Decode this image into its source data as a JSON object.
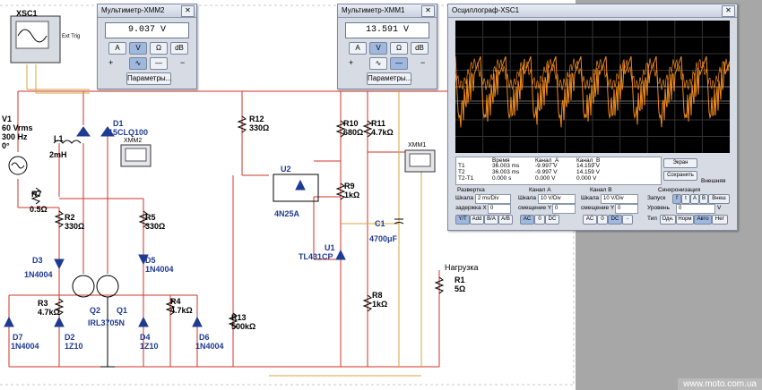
{
  "app": {
    "watermark": "www.moto.com.ua"
  },
  "xsc1_label": "XSC1",
  "xsc1_ext": "Ext Trig",
  "source": {
    "name": "V1",
    "amp": "60 Vrms",
    "freq": "300 Hz",
    "phase": "0°"
  },
  "components": {
    "L1": {
      "name": "L1",
      "value": "2mH"
    },
    "D1": {
      "name": "D1",
      "value": "15CLQ100"
    },
    "R7": {
      "name": "R7",
      "value": "0.5Ω"
    },
    "R2": {
      "name": "R2",
      "value": "330Ω"
    },
    "R5": {
      "name": "R5",
      "value": "330Ω"
    },
    "D3": {
      "name": "D3",
      "value": "1N4004"
    },
    "D5": {
      "name": "D5",
      "value": "1N4004"
    },
    "R3": {
      "name": "R3",
      "value": "4.7kΩ"
    },
    "R4": {
      "name": "R4",
      "value": "4.7kΩ"
    },
    "Q2": {
      "name": "Q2"
    },
    "Q1": {
      "name": "Q1",
      "value": "IRL3705N"
    },
    "D7": {
      "name": "D7",
      "value": "1N4004"
    },
    "D2": {
      "name": "D2",
      "value": "1Z10"
    },
    "D4": {
      "name": "D4",
      "value": "1Z10"
    },
    "D6": {
      "name": "D6",
      "value": "1N4004"
    },
    "R12": {
      "name": "R12",
      "value": "330Ω"
    },
    "R13": {
      "name": "R13",
      "value": "500kΩ"
    },
    "U2": {
      "name": "U2",
      "value": "4N25A"
    },
    "R10": {
      "name": "R10",
      "value": "680Ω"
    },
    "R11": {
      "name": "R11",
      "value": "4.7kΩ"
    },
    "R9": {
      "name": "R9",
      "value": "1kΩ"
    },
    "U1": {
      "name": "U1",
      "value": "TL431CP"
    },
    "C1": {
      "name": "C1",
      "value": "4700μF"
    },
    "R8": {
      "name": "R8",
      "value": "1kΩ"
    },
    "R1": {
      "name": "R1",
      "value": "5Ω",
      "label": "Нагрузка"
    },
    "XMM2": {
      "name": "XMM2"
    },
    "XMM1": {
      "name": "XMM1"
    }
  },
  "multimeter2": {
    "title": "Мультиметр-XMM2",
    "reading": "9.037 V",
    "mode_buttons": [
      "A",
      "V",
      "Ω",
      "dB"
    ],
    "plus": "+",
    "minus": "−",
    "params": "Параметры..."
  },
  "multimeter1": {
    "title": "Мультиметр-XMM1",
    "reading": "13.591 V",
    "mode_buttons": [
      "A",
      "V",
      "Ω",
      "dB"
    ],
    "plus": "+",
    "minus": "−",
    "params": "Параметры..."
  },
  "oscilloscope": {
    "title": "Осциллограф-XSC1",
    "colors": {
      "trace": "#f08a1c",
      "screen": "#000000",
      "grid": "#3a3a3a"
    },
    "cursor_header": [
      "Время",
      "Канал_A",
      "Канал_B"
    ],
    "rows": [
      {
        "name": "T1",
        "time": "36.003 ms",
        "a": "-9.997 V",
        "b": "14.159 V"
      },
      {
        "name": "T2",
        "time": "36.003 ms",
        "a": "-9.997 V",
        "b": "14.159 V"
      },
      {
        "name": "T2-T1",
        "time": "0.000 s",
        "a": "0.000 V",
        "b": "0.000 V"
      }
    ],
    "screen_btn": "Экран",
    "save_btn": "Сохранить",
    "ext_label": "Внешняя",
    "sweep": {
      "title": "Развертка",
      "scale_label": "Шкала",
      "scale": "2 ms/Div",
      "x_label": "задержка X",
      "x_val": "0",
      "modes": [
        "Y/T",
        "Add",
        "B/A",
        "A/B"
      ]
    },
    "chA": {
      "title": "Канал A",
      "scale_label": "Шкала",
      "scale": "10 V/Div",
      "y_label": "смещение Y",
      "y_val": "0",
      "modes": [
        "AC",
        "0",
        "DC"
      ]
    },
    "chB": {
      "title": "Канал B",
      "scale_label": "Шкала",
      "scale": "10 V/Div",
      "y_label": "смещение Y",
      "y_val": "0",
      "modes": [
        "AC",
        "0",
        "DC",
        "-"
      ]
    },
    "sync": {
      "title": "Синхронизация",
      "start_label": "Запуск",
      "edge": [
        "f",
        "t"
      ],
      "src": [
        "A",
        "B",
        "Внеш"
      ],
      "level_label": "Уровень",
      "level": "0",
      "level_unit": "V",
      "type_label": "Тип",
      "types": [
        "Одн.",
        "Норм",
        "Авто",
        "Нет"
      ]
    }
  }
}
